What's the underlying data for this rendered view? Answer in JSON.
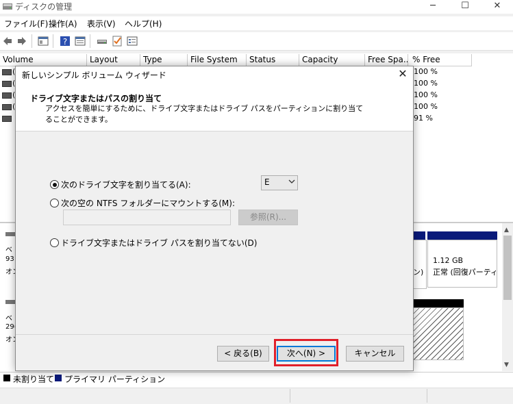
{
  "window": {
    "title": "ディスクの管理",
    "controls": [
      "─",
      "☐",
      "✕"
    ]
  },
  "menu": [
    "ファイル(F)",
    "操作(A)",
    "表示(V)",
    "ヘルプ(H)"
  ],
  "volume_table": {
    "columns": [
      "Volume",
      "Layout",
      "Type",
      "File System",
      "Status",
      "Capacity",
      "Free Spa...",
      "% Free"
    ],
    "rows": [
      {
        "volume": "(",
        "pct_free": "100 %"
      },
      {
        "volume": "(",
        "pct_free": "100 %"
      },
      {
        "volume": "(",
        "pct_free": "100 %"
      },
      {
        "volume": "(",
        "pct_free": "100 %"
      },
      {
        "volume": "",
        "pct_free": "91 %"
      }
    ]
  },
  "disks": [
    {
      "line1": "ベ",
      "line2": "93",
      "line3": "オン"
    },
    {
      "line1": "ベ",
      "line2": "29(",
      "line3": "オン"
    }
  ],
  "partitions": {
    "recovery_size": "1.12 GB",
    "recovery_status": "正常 (回復パーティ",
    "partial_text": "ン)"
  },
  "legend": {
    "unallocated": "未割り当て",
    "primary": "プライマリ パーティション"
  },
  "wizard": {
    "title": "新しいシンプル ボリューム ウィザード",
    "heading": "ドライブ文字またはパスの割り当て",
    "description": "アクセスを簡単にするために、ドライブ文字またはドライブ パスをパーティションに割り当てることができます。",
    "option_assign_letter": "次のドライブ文字を割り当てる(A):",
    "option_mount_folder": "次の空の NTFS フォルダーにマウントする(M):",
    "option_none": "ドライブ文字またはドライブ パスを割り当てない(D)",
    "drive_letter": "E",
    "browse_label": "参照(R)...",
    "back_label": "< 戻る(B)",
    "next_label": "次へ(N) >",
    "cancel_label": "キャンセル"
  },
  "colors": {
    "primary_partition": "#0a1a7a",
    "unallocated": "#000000",
    "highlight": "#e0202a",
    "focus": "#0078d7"
  }
}
